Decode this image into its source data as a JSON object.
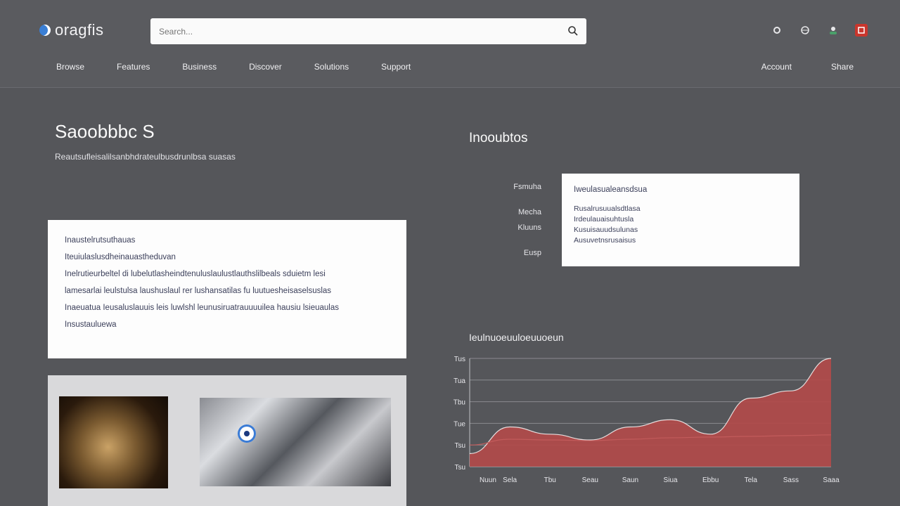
{
  "header": {
    "logo_text": "oragfis",
    "search_placeholder": "Search...",
    "nav": [
      "Browse",
      "Features",
      "Business",
      "Discover",
      "Solutions",
      "Support"
    ],
    "nav_right": [
      "Account",
      "Share"
    ],
    "icons": [
      "settings-icon",
      "globe-icon",
      "user-icon",
      "notifications-icon"
    ]
  },
  "main": {
    "title": "Saoobbbc S",
    "subtitle": "Reautsufleisalilsanbhdrateulbusdrunlbsa suasas",
    "card": {
      "heading": "Inaustelrutsuthauas",
      "line2": "Iteuiulaslusdheinauastheduvan",
      "line3": "Inelrutieurbeltel di lubelutlasheindtenuluslaulustlauthslilbeals sduietm lesi",
      "line4": "lamesarlai leulstulsa laushuslaul rer lushansatilas fu luutuesheisaselsuslas",
      "line5": "Inaeuatua Ieusaluslauuis leis luwlshl leunusiruatrauuuuilea hausiu lsieuaulas",
      "line6": "Insustauluewa"
    },
    "images": [
      "photo-collage",
      "photo-eye"
    ]
  },
  "details": {
    "title": "Inooubtos",
    "labels": [
      "Fsmuha",
      "Mecha",
      "Kluuns",
      "Eusp"
    ],
    "card_heading": "Iweulasualeansdsua",
    "card_items": [
      "Rusalrusuualsdtlasa",
      "Irdeulauaisuhtusla",
      "Kusuisauudsulunas",
      "Ausuvetnsrusaisus"
    ]
  },
  "chart_data": {
    "type": "area",
    "title": "Ieulnuoeuuloeuuoeun",
    "categories": [
      "Nuun",
      "Sela",
      "Tbu",
      "Seau",
      "Saun",
      "Siua",
      "Ebbu",
      "Tela",
      "Sass",
      "Saaa"
    ],
    "y_ticks": [
      "Tus",
      "Tua",
      "Tbu",
      "Tue",
      "Tsu",
      "Tsu"
    ],
    "series": [
      {
        "values": [
          18,
          55,
          45,
          37,
          55,
          65,
          45,
          95,
          105,
          150
        ]
      }
    ],
    "line2": [
      30,
      38,
      37,
      36,
      38,
      40,
      41,
      42,
      43,
      44
    ],
    "ylim": [
      0,
      150
    ],
    "grid": true,
    "fill_color": "#b24a4a",
    "line_color": "#ffffff"
  }
}
